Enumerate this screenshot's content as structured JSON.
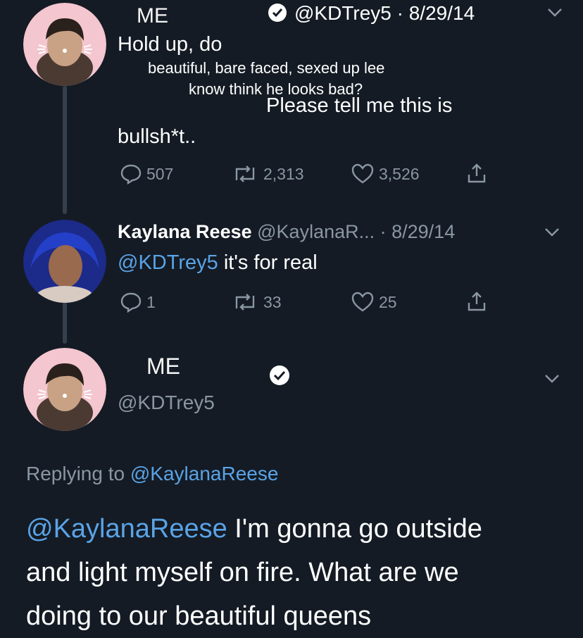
{
  "tweet1": {
    "overlay_name": "ME",
    "handle_date": "@KDTrey5 · 8/29/14",
    "text_line1": "Hold up, do",
    "caption_line1": "beautiful, bare faced, sexed up lee",
    "caption_line2": "know think he looks bad?",
    "text_mid": "Please tell me this is",
    "text_end": "bullsh*t..",
    "replies": "507",
    "retweets": "2,313",
    "likes": "3,526"
  },
  "tweet2": {
    "name": "Kaylana Reese",
    "handle": "@KaylanaR...",
    "date": "· 8/29/14",
    "mention": "@KDTrey5",
    "text": " it's for real",
    "replies": "1",
    "retweets": "33",
    "likes": "25"
  },
  "tweet3": {
    "overlay_name": "ME",
    "handle": "@KDTrey5",
    "replying_prefix": "Replying to ",
    "replying_to": "@KaylanaReese",
    "mention": "@KaylanaReese",
    "line1": " I'm gonna go outside",
    "line2": "and light myself on fire. What are we",
    "line3": "doing to our beautiful queens"
  },
  "colors": {
    "background": "#141b24",
    "link": "#5aa3e6",
    "muted": "#8a96a3",
    "avatar_frame": "#f4c6cf"
  },
  "icons": [
    "verified-badge-icon",
    "chevron-down-icon",
    "reply-icon",
    "retweet-icon",
    "like-icon",
    "share-icon"
  ]
}
